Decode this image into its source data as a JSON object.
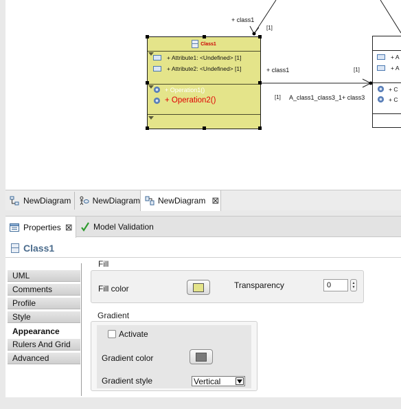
{
  "diagram": {
    "class1": {
      "name": "Class1",
      "attributes": [
        "+ Attribute1: <Undefined> [1]",
        "+ Attribute2: <Undefined> [1]"
      ],
      "operations": [
        "+ Operation1()",
        "+ Operation2()"
      ]
    },
    "class3": {
      "attributes": [
        "+ A",
        "+ A"
      ],
      "operations": [
        "+ C",
        "+ C"
      ]
    },
    "labels": {
      "top_role": "+ class1",
      "top_mult": "[1]",
      "right_role": "+ class1",
      "right_mult": "[1]",
      "assoc_mult": "[1]",
      "assoc_name": "A_class1_class3_1+ class3"
    },
    "colors": {
      "class_fill": "#e4e48a",
      "title_text": "#cc0000",
      "operation_text": "#e00000"
    }
  },
  "diagram_tabs": [
    {
      "label": "NewDiagram",
      "icon": "diagram-icon"
    },
    {
      "label": "NewDiagram",
      "icon": "diagram-icon"
    },
    {
      "label": "NewDiagram",
      "icon": "class-diagram-icon",
      "close": "⊠"
    }
  ],
  "properties_view": {
    "tabs": [
      {
        "label": "Properties",
        "icon": "properties-icon",
        "close": "⊠"
      },
      {
        "label": "Model Validation",
        "icon": "check-icon"
      }
    ],
    "selection_title": "Class1",
    "categories": [
      "UML",
      "Comments",
      "Profile",
      "Style",
      "Appearance",
      "Rulers And Grid",
      "Advanced"
    ],
    "active_category": "Appearance",
    "fill": {
      "group_label": "Fill",
      "fill_color_label": "Fill color",
      "fill_color_value": "#e4e48a",
      "transparency_label": "Transparency",
      "transparency_value": "0"
    },
    "gradient": {
      "group_label": "Gradient",
      "activate_label": "Activate",
      "activate_checked": false,
      "gradient_color_label": "Gradient color",
      "gradient_color_value": "#7a7a7a",
      "gradient_style_label": "Gradient style",
      "gradient_style_value": "Vertical"
    }
  }
}
